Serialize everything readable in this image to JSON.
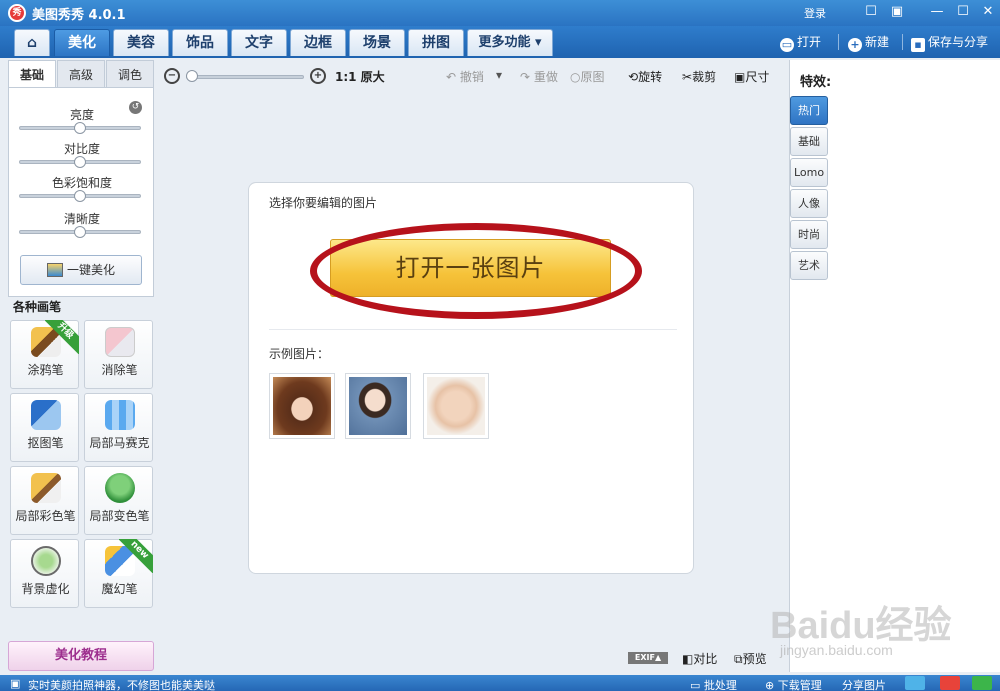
{
  "app": {
    "logo_text": "秀",
    "title": "美图秀秀 4.0.1",
    "login": "登录"
  },
  "window_controls": {
    "message": "☐",
    "skin": "▣",
    "minimize": "—",
    "maximize": "☐",
    "close": "✕"
  },
  "tabs": [
    {
      "label": "⌂",
      "icon": "home-icon"
    },
    {
      "label": "美化"
    },
    {
      "label": "美容"
    },
    {
      "label": "饰品"
    },
    {
      "label": "文字"
    },
    {
      "label": "边框"
    },
    {
      "label": "场景"
    },
    {
      "label": "拼图"
    },
    {
      "label": "更多功能 ▾"
    }
  ],
  "top_actions": {
    "open": "打开",
    "new": "新建",
    "save_share": "保存与分享"
  },
  "left": {
    "subtabs": [
      "基础",
      "高级",
      "调色"
    ],
    "sliders": [
      {
        "label": "亮度",
        "level": 0.5
      },
      {
        "label": "对比度",
        "level": 0.5
      },
      {
        "label": "色彩饱和度",
        "level": 0.5
      },
      {
        "label": "清晰度",
        "level": 0.5
      }
    ],
    "one_key": "一键美化",
    "brushes_title": "各种画笔",
    "brushes": [
      {
        "label": "涂鸦笔",
        "badge": "升级",
        "icon": "brush-icon"
      },
      {
        "label": "消除笔",
        "badge": "",
        "icon": "eraser-icon"
      },
      {
        "label": "抠图笔",
        "badge": "",
        "icon": "cutout-pen-icon"
      },
      {
        "label": "局部马赛克",
        "badge": "",
        "icon": "mosaic-icon"
      },
      {
        "label": "局部彩色笔",
        "badge": "",
        "icon": "color-brush-icon"
      },
      {
        "label": "局部变色笔",
        "badge": "",
        "icon": "paint-bucket-icon"
      },
      {
        "label": "背景虚化",
        "badge": "",
        "icon": "blur-icon"
      },
      {
        "label": "魔幻笔",
        "badge": "new",
        "icon": "magic-pen-icon"
      }
    ],
    "tutorial": "美化教程"
  },
  "toolbar": {
    "actual_size": "1:1 原大",
    "undo": "撤销",
    "redo": "重做",
    "original": "原图",
    "rotate": "旋转",
    "crop": "裁剪",
    "resize": "尺寸"
  },
  "card": {
    "prompt": "选择你要编辑的图片",
    "open_button": "打开一张图片",
    "examples_label": "示例图片："
  },
  "bottom": {
    "exif": "EXIF▲",
    "compare": "对比",
    "preview": "预览"
  },
  "right": {
    "title": "特效:",
    "tabs": [
      "热门",
      "基础",
      "Lomo",
      "人像",
      "时尚",
      "艺术"
    ]
  },
  "status": {
    "left_text": "实时美颜拍照神器，不修图也能美美哒",
    "batch": "批处理",
    "download": "下载管理",
    "share": "分享图片"
  },
  "watermark": {
    "big": "Baidu经验",
    "small": "jingyan.baidu.com"
  }
}
